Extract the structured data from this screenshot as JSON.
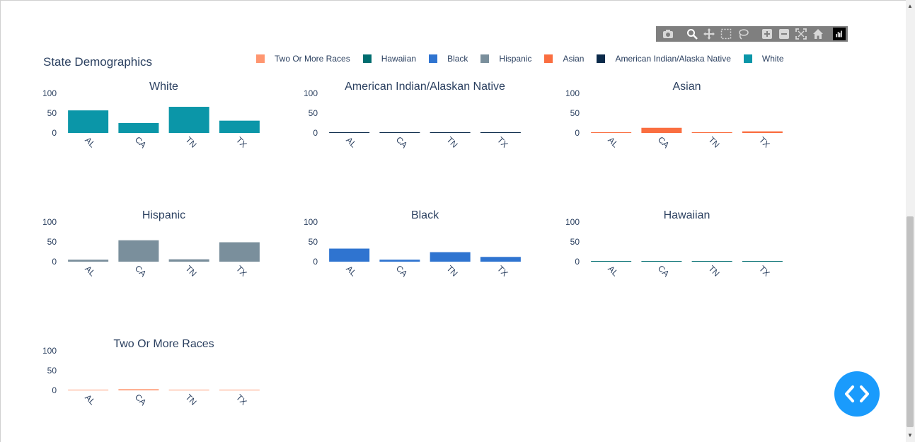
{
  "title": "State Demographics",
  "legend": [
    {
      "label": "Two Or More Races",
      "color": "#ff9670"
    },
    {
      "label": "Hawaiian",
      "color": "#006d6f"
    },
    {
      "label": "Black",
      "color": "#2f74d0"
    },
    {
      "label": "Hispanic",
      "color": "#7a8f9c"
    },
    {
      "label": "Asian",
      "color": "#fa6e40"
    },
    {
      "label": "American Indian/Alaska Native",
      "color": "#0b2a4a"
    },
    {
      "label": "White",
      "color": "#0b96a8"
    }
  ],
  "modebar": [
    "camera-icon",
    "zoom-icon",
    "pan-icon",
    "box-select-icon",
    "lasso-icon",
    "zoom-in-icon",
    "zoom-out-icon",
    "autoscale-icon",
    "reset-axes-icon",
    "plotly-logo-icon"
  ],
  "chart_data": [
    {
      "type": "bar",
      "title": "White",
      "categories": [
        "AL",
        "CA",
        "TN",
        "TX"
      ],
      "values": [
        57,
        25,
        66,
        31
      ],
      "ylim": [
        0,
        100
      ],
      "yticks": [
        "100",
        "50",
        "0"
      ],
      "color": "#0b96a8"
    },
    {
      "type": "bar",
      "title": "American Indian/Alaskan Native",
      "categories": [
        "AL",
        "CA",
        "TN",
        "TX"
      ],
      "values": [
        0.8,
        0.4,
        0.3,
        0.3
      ],
      "ylim": [
        0,
        100
      ],
      "yticks": [
        "100",
        "50",
        "0"
      ],
      "color": "#0b2a4a"
    },
    {
      "type": "bar",
      "title": "Asian",
      "categories": [
        "AL",
        "CA",
        "TN",
        "TX"
      ],
      "values": [
        1.5,
        13,
        2,
        4
      ],
      "ylim": [
        0,
        100
      ],
      "yticks": [
        "100",
        "50",
        "0"
      ],
      "color": "#fa6e40"
    },
    {
      "type": "bar",
      "title": "Hispanic",
      "categories": [
        "AL",
        "CA",
        "TN",
        "TX"
      ],
      "values": [
        5,
        54,
        6,
        49
      ],
      "ylim": [
        0,
        100
      ],
      "yticks": [
        "100",
        "50",
        "0"
      ],
      "color": "#7a8f9c"
    },
    {
      "type": "bar",
      "title": "Black",
      "categories": [
        "AL",
        "CA",
        "TN",
        "TX"
      ],
      "values": [
        33,
        5,
        24,
        12
      ],
      "ylim": [
        0,
        100
      ],
      "yticks": [
        "100",
        "50",
        "0"
      ],
      "color": "#2f74d0"
    },
    {
      "type": "bar",
      "title": "Hawaiian",
      "categories": [
        "AL",
        "CA",
        "TN",
        "TX"
      ],
      "values": [
        0.1,
        0.3,
        0.1,
        0.1
      ],
      "ylim": [
        0,
        100
      ],
      "yticks": [
        "100",
        "50",
        "0"
      ],
      "color": "#006d6f"
    },
    {
      "type": "bar",
      "title": "Two Or More Races",
      "categories": [
        "AL",
        "CA",
        "TN",
        "TX"
      ],
      "values": [
        1.5,
        3,
        1.5,
        1.5
      ],
      "ylim": [
        0,
        100
      ],
      "yticks": [
        "100",
        "50",
        "0"
      ],
      "color": "#ff9670"
    }
  ]
}
